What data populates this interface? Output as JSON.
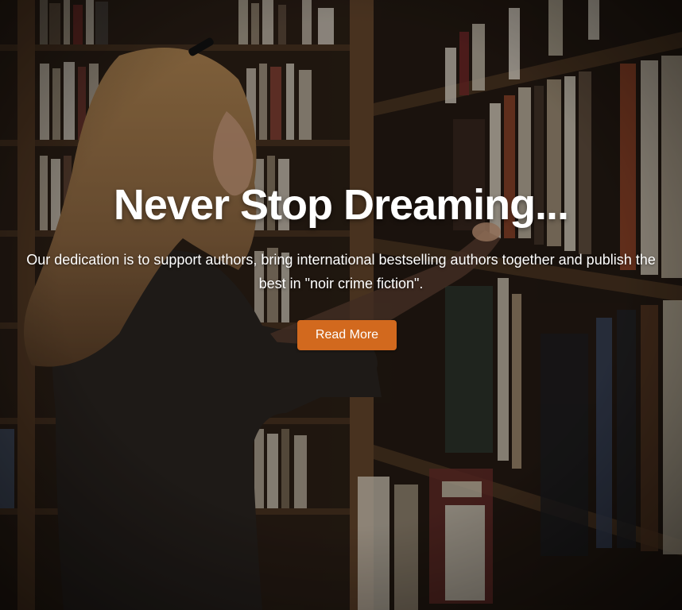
{
  "hero": {
    "headline": "Never Stop Dreaming...",
    "subtext": "Our dedication is to support authors, bring international bestselling authors together and publish the best in \"noir crime fiction\".",
    "cta_label": "Read More"
  },
  "colors": {
    "cta_background": "#d2691e",
    "headline_text": "#ffffff"
  }
}
